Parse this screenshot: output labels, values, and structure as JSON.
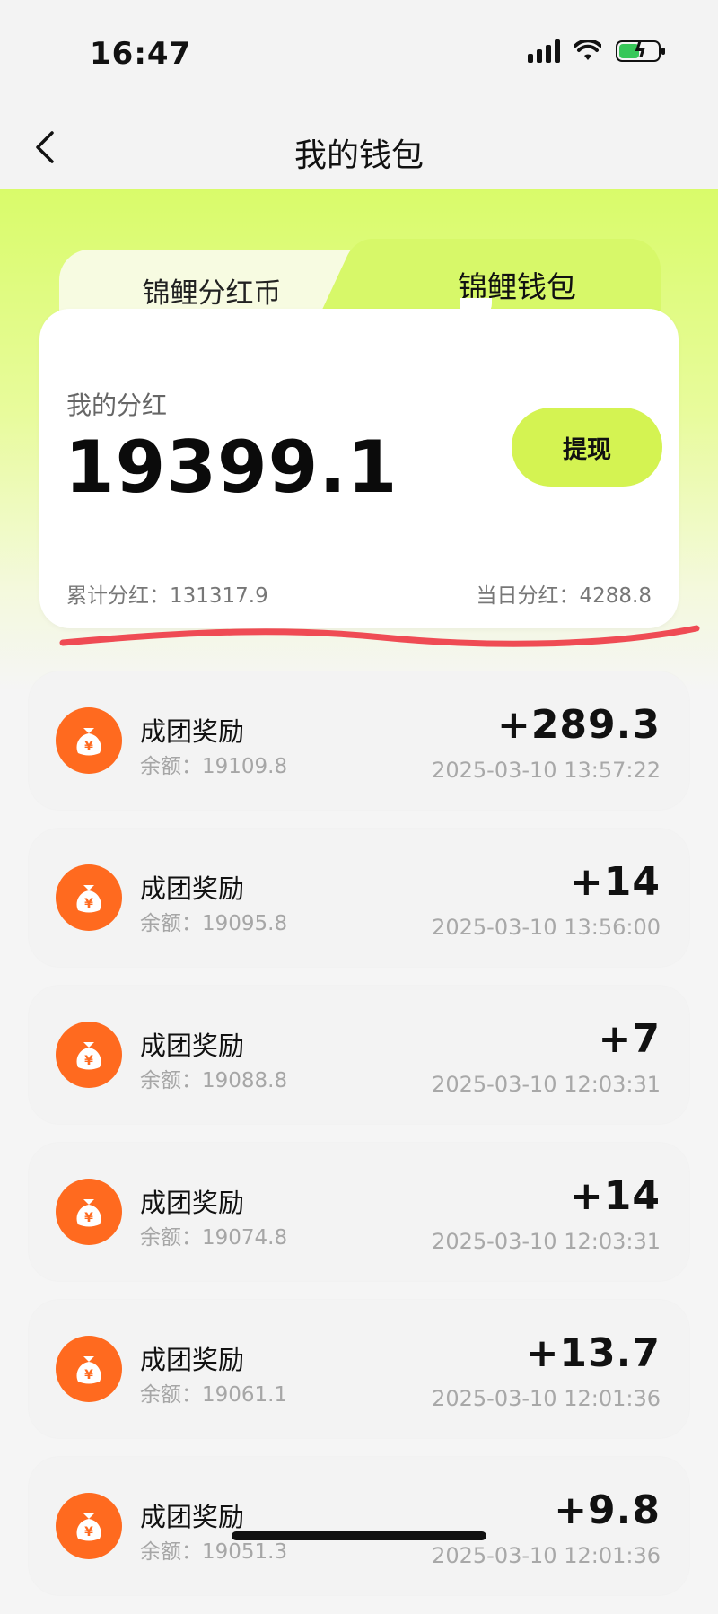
{
  "status_bar": {
    "time": "16:47"
  },
  "nav": {
    "title": "我的钱包"
  },
  "tabs": {
    "left_label": "锦鲤分红币",
    "right_label": "锦鲤钱包",
    "active": "锦鲤钱包"
  },
  "card": {
    "label": "我的分红",
    "amount": "19399.1",
    "withdraw_label": "提现",
    "total_dividend": "累计分红：131317.9",
    "daily_dividend": "当日分红：4288.8"
  },
  "colors": {
    "accent_green": "#d4f352",
    "icon_orange": "#ff6a1f",
    "underline_red": "#ef4b54"
  },
  "transactions": [
    {
      "title": "成团奖励",
      "balance": "余额：19109.8",
      "amount": "+289.3",
      "time": "2025-03-10 13:57:22"
    },
    {
      "title": "成团奖励",
      "balance": "余额：19095.8",
      "amount": "+14",
      "time": "2025-03-10 13:56:00"
    },
    {
      "title": "成团奖励",
      "balance": "余额：19088.8",
      "amount": "+7",
      "time": "2025-03-10 12:03:31"
    },
    {
      "title": "成团奖励",
      "balance": "余额：19074.8",
      "amount": "+14",
      "time": "2025-03-10 12:03:31"
    },
    {
      "title": "成团奖励",
      "balance": "余额：19061.1",
      "amount": "+13.7",
      "time": "2025-03-10 12:01:36"
    },
    {
      "title": "成团奖励",
      "balance": "余额：19051.3",
      "amount": "+9.8",
      "time": "2025-03-10 12:01:36"
    }
  ]
}
